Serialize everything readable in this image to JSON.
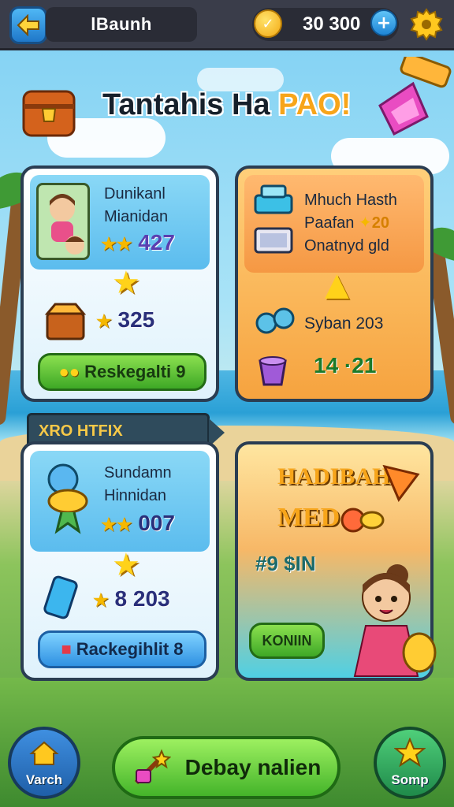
{
  "topbar": {
    "player_name": "lBaunh",
    "coin_amount": "30 300",
    "plus_label": "+"
  },
  "title": {
    "main": "Tantahis Ha ",
    "highlight": "PAO!"
  },
  "cards": {
    "top_left": {
      "line1": "Dunikanl",
      "line2": "Mianidan",
      "stat1_stars": "★★",
      "stat1_value": "427",
      "stat2_value": "325",
      "button_label": "Reskegalti 9"
    },
    "top_right": {
      "line1": "Mhuch Hasth",
      "line2": "Paafan",
      "line2_value": "20",
      "line3": "Onatnyd gld",
      "stat1_label": "Syban 203",
      "stat2_value": "14 ·21"
    },
    "section_tag": "XRO HTFIX",
    "bottom_left": {
      "line1": "Sundamn",
      "line2": "Hinnidan",
      "stat1_stars": "★★",
      "stat1_value": "007",
      "stat2_value": "8 203",
      "button_label": "Rackegihlit 8"
    },
    "hero": {
      "title1": "HADIBAH",
      "title2": "MED",
      "code": "#9 $IN",
      "button_label": "KONIIN"
    }
  },
  "bottom_bar": {
    "left_label": "Varch",
    "cta_label": "Debay nalien",
    "right_label": "Somp"
  },
  "icons": {
    "back": "back-arrow-icon",
    "coin": "coin-icon",
    "settings": "gear-icon"
  },
  "colors": {
    "accent_orange": "#f7a51a",
    "cta_green": "#44b42a",
    "card_border": "#2a3d52"
  }
}
